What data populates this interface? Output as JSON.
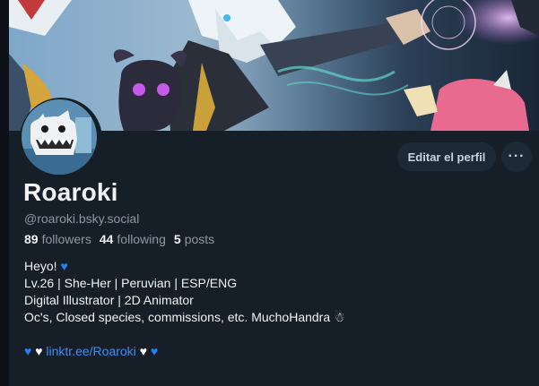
{
  "profile": {
    "display_name": "Roaroki",
    "handle": "@roaroki.bsky.social",
    "stats": {
      "followers_count": "89",
      "followers_label": "followers",
      "following_count": "44",
      "following_label": "following",
      "posts_count": "5",
      "posts_label": "posts"
    },
    "bio": {
      "line1_text": "Heyo!",
      "line2": "Lv.26 | She-Her | Peruvian | ESP/ENG",
      "line3": "Digital Illustrator | 2D Animator",
      "line4_text": "Oc's, Closed species, commissions, etc. MuchoHandra",
      "link_text": "linktr.ee/Roaroki"
    }
  },
  "actions": {
    "edit_profile_label": "Editar el perfil",
    "more_label": "···"
  },
  "icons": {
    "blue_heart": "blue-heart-icon",
    "white_heart": "white-heart-icon",
    "snowman": "snowman-icon",
    "more": "more-options-icon"
  },
  "colors": {
    "background": "#161e27",
    "button_bg": "#1e2936",
    "link": "#3b8ef7",
    "blue_heart": "#1d84f4",
    "muted_text": "#8b98a5",
    "primary_text": "#f1f3f5"
  }
}
